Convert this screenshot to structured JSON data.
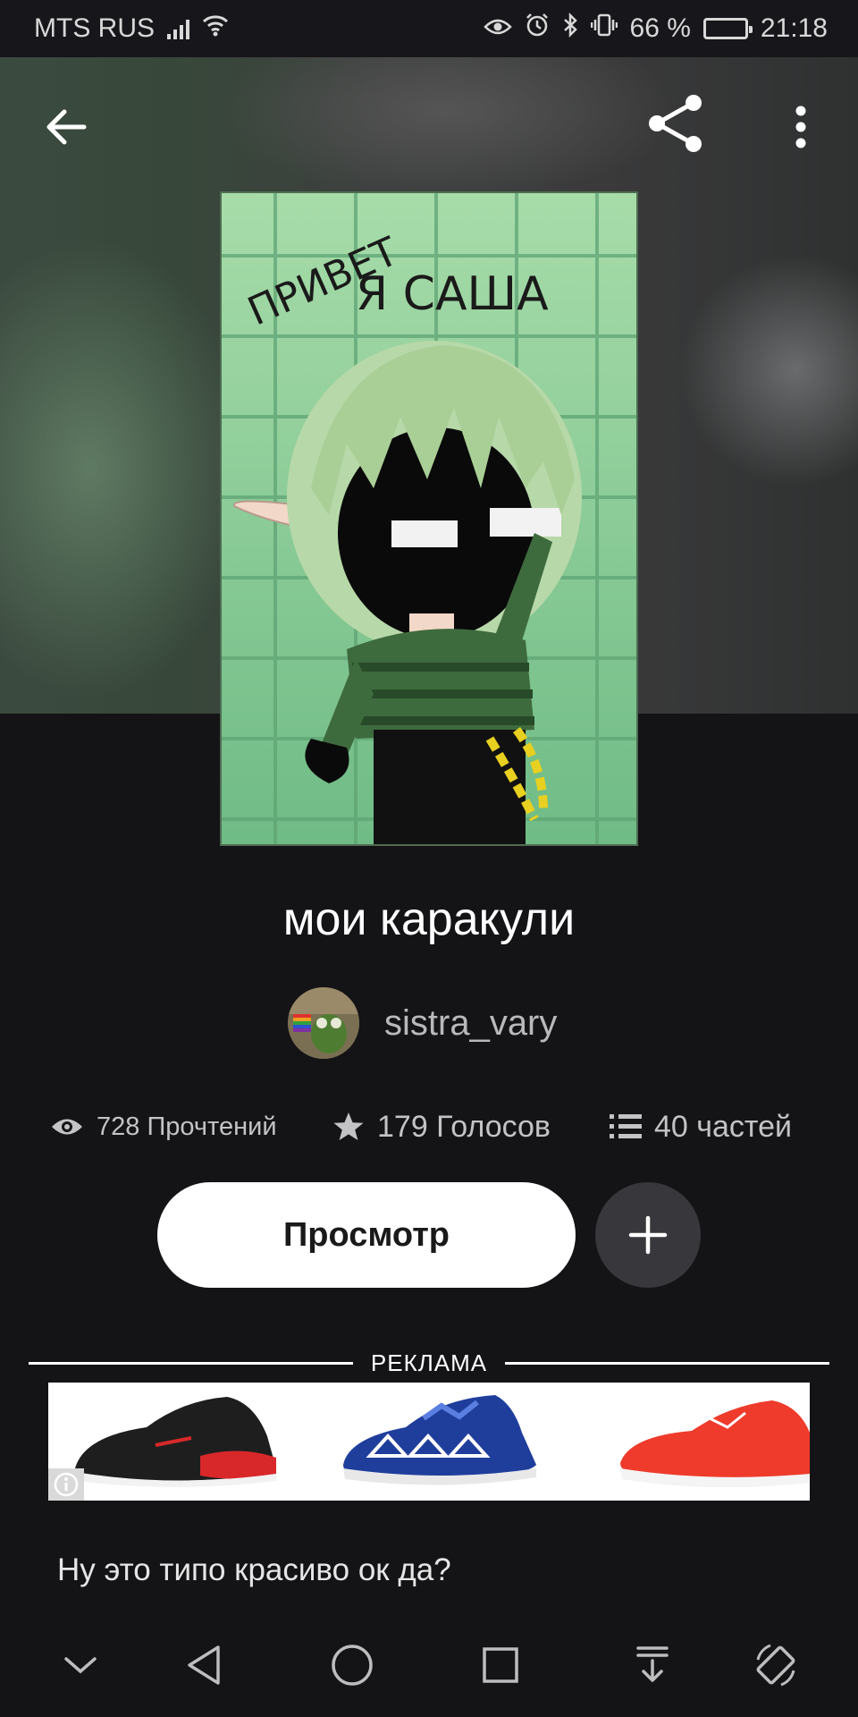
{
  "status_bar": {
    "carrier": "MTS RUS",
    "battery_percent": "66 %",
    "battery_level": 0.66,
    "time": "21:18"
  },
  "header": {
    "back_icon": "arrow-left-icon",
    "share_icon": "share-icon",
    "more_icon": "more-vertical-icon"
  },
  "cover": {
    "text_line1": "ПРИВЕТ",
    "text_line2": "Я САША"
  },
  "story": {
    "title": "мои каракули",
    "author": "sistra_vary"
  },
  "stats": {
    "reads": "728 Прочтений",
    "votes": "179 Голосов",
    "parts": "40 частей"
  },
  "actions": {
    "read_label": "Просмотр",
    "add_icon": "plus-icon"
  },
  "ad": {
    "label": "РЕКЛАМА",
    "info_icon": "info-icon"
  },
  "description": "Ну это типо красиво ок да?",
  "colors": {
    "background": "#141316",
    "button_primary": "#ffffff",
    "button_secondary": "#38373b"
  }
}
